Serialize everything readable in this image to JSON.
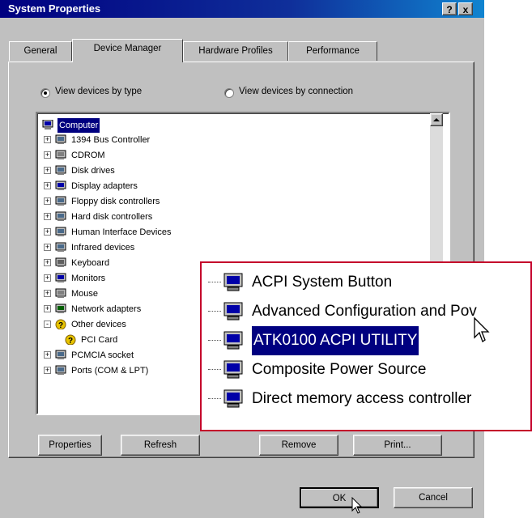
{
  "window": {
    "title": "System Properties",
    "help_button": "?",
    "close_button": "x"
  },
  "tabs": [
    "General",
    "Device Manager",
    "Hardware Profiles",
    "Performance"
  ],
  "view_options": {
    "by_type": "View devices by type",
    "by_connection": "View devices by connection",
    "selected": "by_type"
  },
  "tree": {
    "root": "Computer",
    "items": [
      {
        "label": "1394 Bus Controller",
        "icon": "bus-controller-icon",
        "expander": "+"
      },
      {
        "label": "CDROM",
        "icon": "cdrom-icon",
        "expander": "+"
      },
      {
        "label": "Disk drives",
        "icon": "disk-drive-icon",
        "expander": "+"
      },
      {
        "label": "Display adapters",
        "icon": "monitor-icon",
        "expander": "+"
      },
      {
        "label": "Floppy disk controllers",
        "icon": "floppy-controller-icon",
        "expander": "+"
      },
      {
        "label": "Hard disk controllers",
        "icon": "hard-disk-controller-icon",
        "expander": "+"
      },
      {
        "label": "Human Interface Devices",
        "icon": "hid-icon",
        "expander": "+"
      },
      {
        "label": "Infrared devices",
        "icon": "infrared-icon",
        "expander": "+"
      },
      {
        "label": "Keyboard",
        "icon": "keyboard-icon",
        "expander": "+"
      },
      {
        "label": "Monitors",
        "icon": "monitor-icon",
        "expander": "+"
      },
      {
        "label": "Mouse",
        "icon": "mouse-icon",
        "expander": "+"
      },
      {
        "label": "Network adapters",
        "icon": "network-adapter-icon",
        "expander": "+"
      },
      {
        "label": "Other devices",
        "icon": "question-icon",
        "expander": "-"
      },
      {
        "label": "PCI Card",
        "icon": "question-icon",
        "expander": ""
      },
      {
        "label": "PCMCIA socket",
        "icon": "pcmcia-icon",
        "expander": "+"
      },
      {
        "label": "Ports (COM & LPT)",
        "icon": "port-icon",
        "expander": "+"
      }
    ]
  },
  "buttons": {
    "properties": "Properties",
    "refresh": "Refresh",
    "remove": "Remove",
    "print": "Print...",
    "ok": "OK",
    "cancel": "Cancel"
  },
  "zoom_callout": {
    "items": [
      {
        "label": "ACPI System Button"
      },
      {
        "label": "Advanced Configuration and Pov"
      },
      {
        "label": "ATK0100 ACPI UTILITY",
        "selected": true
      },
      {
        "label": "Composite Power Source"
      },
      {
        "label": "Direct memory access controller"
      }
    ],
    "border_color": "#c4002a"
  },
  "colors": {
    "title_bar": "#000080",
    "selection": "#000080",
    "face": "#c0c0c0"
  }
}
